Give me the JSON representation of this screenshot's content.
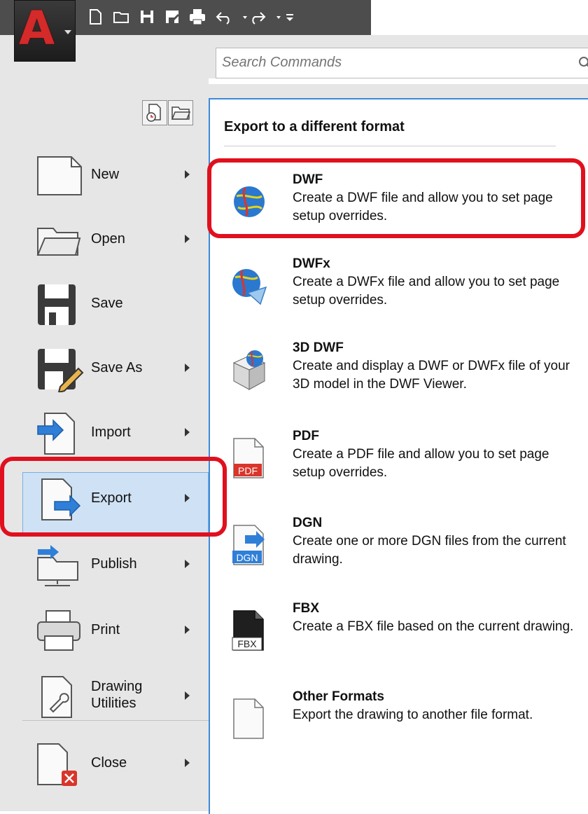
{
  "app": {
    "logo_letter": "A",
    "accent": "#d42a2a",
    "highlight_color": "#e0101e"
  },
  "quick_access": [
    "new-icon",
    "open-folder-icon",
    "save-icon",
    "saveas-icon",
    "print-icon",
    "undo-icon",
    "redo-icon",
    "customize-icon"
  ],
  "search": {
    "placeholder": "Search Commands"
  },
  "menu": {
    "items": [
      {
        "label": "New"
      },
      {
        "label": "Open"
      },
      {
        "label": "Save"
      },
      {
        "label": "Save As"
      },
      {
        "label": "Import"
      },
      {
        "label": "Export",
        "selected": true
      },
      {
        "label": "Publish"
      },
      {
        "label": "Print"
      },
      {
        "label_line1": "Drawing",
        "label_line2": "Utilities"
      },
      {
        "label": "Close"
      }
    ]
  },
  "panel": {
    "header": "Export to a different format",
    "items": [
      {
        "title": "DWF",
        "desc": "Create a DWF file and allow you to set page setup overrides.",
        "icon": "dwf-globe-icon"
      },
      {
        "title": "DWFx",
        "desc": "Create a DWFx file and allow you to set page setup overrides.",
        "icon": "dwfx-globe-icon"
      },
      {
        "title": "3D DWF",
        "desc": "Create and display a DWF or DWFx file of your 3D model in the DWF Viewer.",
        "icon": "3d-dwf-icon"
      },
      {
        "title": "PDF",
        "desc": "Create a PDF file and allow you to set page setup overrides.",
        "icon": "pdf-icon",
        "badge": "PDF"
      },
      {
        "title": "DGN",
        "desc": "Create one or more DGN files from the current drawing.",
        "icon": "dgn-icon",
        "badge": "DGN"
      },
      {
        "title": "FBX",
        "desc": "Create a FBX file based on the current drawing.",
        "icon": "fbx-icon",
        "badge": "FBX"
      },
      {
        "title": "Other Formats",
        "desc": "Export the drawing to another file format.",
        "icon": "blank-file-icon"
      }
    ]
  }
}
